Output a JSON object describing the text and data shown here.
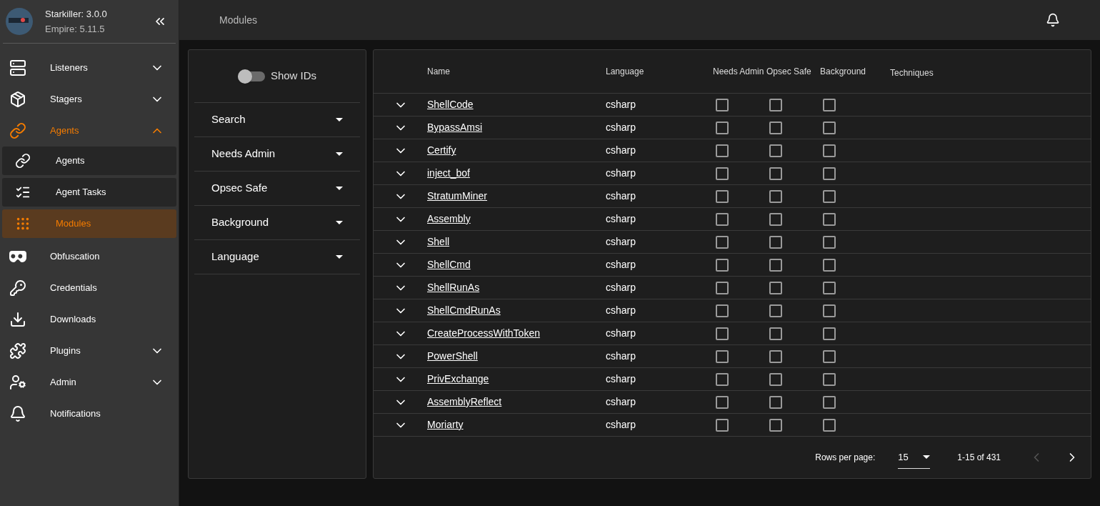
{
  "sidebar": {
    "app_version": "Starkiller: 3.0.0",
    "server_version": "Empire: 5.11.5",
    "items": [
      {
        "label": "Listeners",
        "kind": "group",
        "expanded": false,
        "selected": false
      },
      {
        "label": "Stagers",
        "kind": "group",
        "expanded": false,
        "selected": false
      },
      {
        "label": "Agents",
        "kind": "group",
        "expanded": true,
        "selected": true,
        "children": [
          {
            "label": "Agents",
            "selected": false
          },
          {
            "label": "Agent Tasks",
            "selected": false
          },
          {
            "label": "Modules",
            "selected": true
          }
        ]
      },
      {
        "label": "Obfuscation",
        "kind": "link",
        "selected": false
      },
      {
        "label": "Credentials",
        "kind": "link",
        "selected": false
      },
      {
        "label": "Downloads",
        "kind": "link",
        "selected": false
      },
      {
        "label": "Plugins",
        "kind": "group",
        "expanded": false,
        "selected": false
      },
      {
        "label": "Admin",
        "kind": "group",
        "expanded": false,
        "selected": false
      },
      {
        "label": "Notifications",
        "kind": "link",
        "selected": false
      }
    ]
  },
  "header": {
    "title": "Modules"
  },
  "filters": {
    "show_ids": {
      "label": "Show IDs",
      "on": false
    },
    "items": [
      "Search",
      "Needs Admin",
      "Opsec Safe",
      "Background",
      "Language"
    ]
  },
  "table": {
    "columns": [
      "Name",
      "Language",
      "Needs Admin",
      "Opsec Safe",
      "Background",
      "Techniques"
    ],
    "rows": [
      {
        "name": "ShellCode",
        "language": "csharp",
        "needs_admin": false,
        "opsec_safe": false,
        "background": false
      },
      {
        "name": "BypassAmsi",
        "language": "csharp",
        "needs_admin": false,
        "opsec_safe": false,
        "background": false
      },
      {
        "name": "Certify",
        "language": "csharp",
        "needs_admin": false,
        "opsec_safe": false,
        "background": false
      },
      {
        "name": "inject_bof",
        "language": "csharp",
        "needs_admin": false,
        "opsec_safe": false,
        "background": false
      },
      {
        "name": "StratumMiner",
        "language": "csharp",
        "needs_admin": false,
        "opsec_safe": false,
        "background": false
      },
      {
        "name": "Assembly",
        "language": "csharp",
        "needs_admin": false,
        "opsec_safe": false,
        "background": false
      },
      {
        "name": "Shell",
        "language": "csharp",
        "needs_admin": false,
        "opsec_safe": false,
        "background": false
      },
      {
        "name": "ShellCmd",
        "language": "csharp",
        "needs_admin": false,
        "opsec_safe": false,
        "background": false
      },
      {
        "name": "ShellRunAs",
        "language": "csharp",
        "needs_admin": false,
        "opsec_safe": false,
        "background": false
      },
      {
        "name": "ShellCmdRunAs",
        "language": "csharp",
        "needs_admin": false,
        "opsec_safe": false,
        "background": false
      },
      {
        "name": "CreateProcessWithToken",
        "language": "csharp",
        "needs_admin": false,
        "opsec_safe": false,
        "background": false
      },
      {
        "name": "PowerShell",
        "language": "csharp",
        "needs_admin": false,
        "opsec_safe": false,
        "background": false
      },
      {
        "name": "PrivExchange",
        "language": "csharp",
        "needs_admin": false,
        "opsec_safe": false,
        "background": false
      },
      {
        "name": "AssemblyReflect",
        "language": "csharp",
        "needs_admin": false,
        "opsec_safe": false,
        "background": false
      },
      {
        "name": "Moriarty",
        "language": "csharp",
        "needs_admin": false,
        "opsec_safe": false,
        "background": false
      }
    ],
    "footer": {
      "rows_per_page_label": "Rows per page:",
      "rows_per_page": "15",
      "range": "1-15 of 431",
      "prev_disabled": true,
      "next_disabled": false
    }
  }
}
